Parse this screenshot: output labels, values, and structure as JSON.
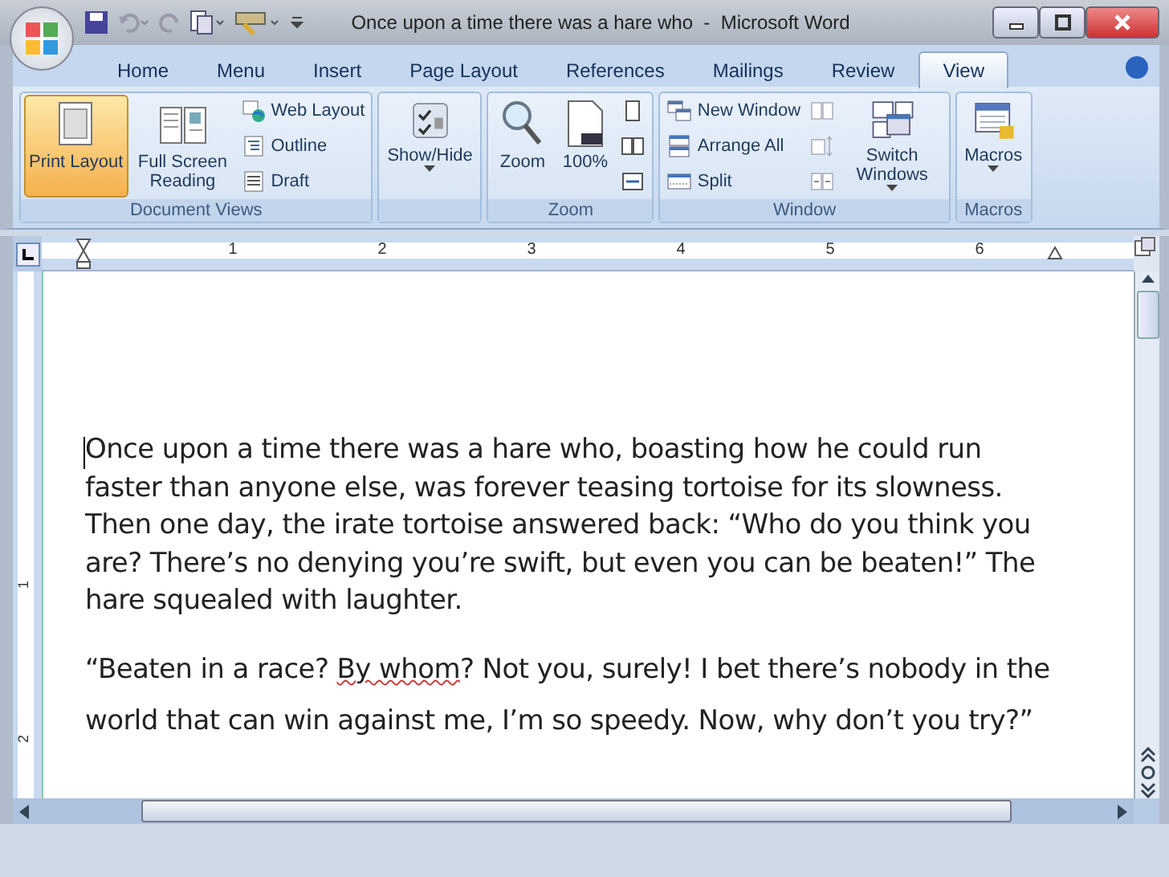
{
  "window": {
    "title": "Once upon a time there was a hare who  -  Microsoft Word"
  },
  "tabs": [
    {
      "label": "Home",
      "selected": false
    },
    {
      "label": "Menu",
      "selected": false
    },
    {
      "label": "Insert",
      "selected": false
    },
    {
      "label": "Page Layout",
      "selected": false
    },
    {
      "label": "References",
      "selected": false
    },
    {
      "label": "Mailings",
      "selected": false
    },
    {
      "label": "Review",
      "selected": false
    },
    {
      "label": "View",
      "selected": true
    }
  ],
  "ribbon_groups": [
    {
      "label": "Document Views",
      "items": [
        {
          "kind": "large",
          "label": "Print Layout",
          "selected": true,
          "has_menu": false
        },
        {
          "kind": "large",
          "label": "Full Screen Reading",
          "selected": false,
          "has_menu": false
        },
        {
          "kind": "stack",
          "items": [
            {
              "label": "Web Layout"
            },
            {
              "label": "Outline"
            },
            {
              "label": "Draft"
            }
          ]
        }
      ]
    },
    {
      "items": [
        {
          "kind": "large",
          "label": "Show/Hide",
          "selected": false,
          "has_menu": true
        }
      ]
    },
    {
      "label": "Zoom",
      "items": [
        {
          "kind": "large",
          "label": "Zoom",
          "selected": false,
          "has_menu": false
        },
        {
          "kind": "large",
          "label": "100%",
          "selected": false,
          "has_menu": false
        },
        {
          "kind": "icon_stack"
        }
      ]
    },
    {
      "label": "Window",
      "items": [
        {
          "kind": "stack",
          "items": [
            {
              "label": "New Window"
            },
            {
              "label": "Arrange All"
            },
            {
              "label": "Split"
            }
          ]
        },
        {
          "kind": "icon_stack"
        },
        {
          "kind": "large",
          "label": "Switch Windows",
          "selected": false,
          "has_menu": true
        }
      ]
    },
    {
      "label": "Macros",
      "items": [
        {
          "kind": "large",
          "label": "Macros",
          "selected": false,
          "has_menu": true
        }
      ]
    }
  ],
  "ruler": {
    "numbers": [
      "1",
      "2",
      "3",
      "4",
      "5",
      "6"
    ]
  },
  "vertical_ruler": {
    "numbers": [
      "1",
      "2"
    ]
  },
  "paragraphs": [
    {
      "kind": "narration",
      "segments": [
        {
          "text": "Once upon a time there was a hare who, boasting how he could run faster than anyone else, was forever teasing tortoise for its slowness. Then one day, the irate tortoise answered back: “Who do you think you are? There’s no denying you’re swift, but even you can be beaten!” The hare squealed with laughter.",
          "misspelled": false
        }
      ]
    },
    {
      "kind": "speech",
      "segments": [
        {
          "text": "“Beaten in a race? ",
          "misspelled": false
        },
        {
          "text": "By whom",
          "misspelled": true
        },
        {
          "text": "? Not you, surely! I bet there’s nobody in the world that can win against me, I’m so speedy. Now, why don’t you try?”",
          "misspelled": false
        }
      ]
    }
  ]
}
